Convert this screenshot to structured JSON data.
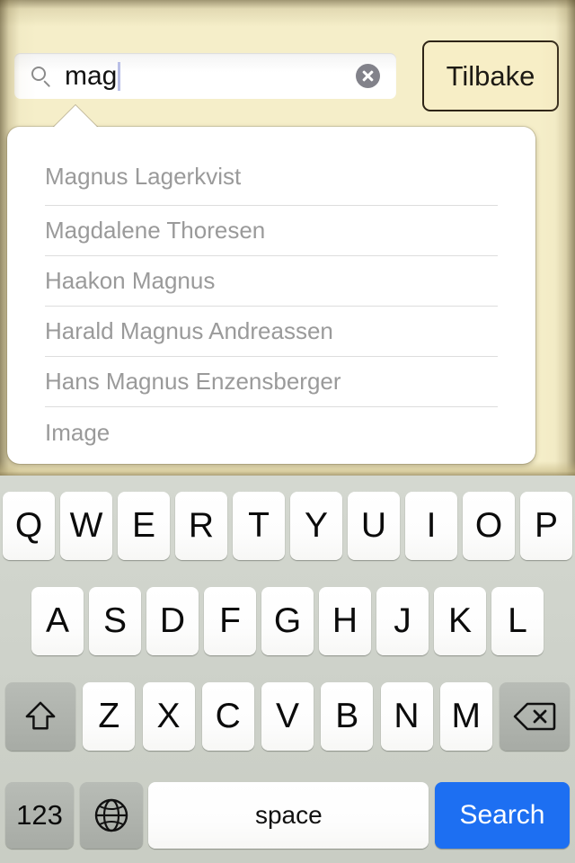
{
  "search": {
    "value": "mag",
    "placeholder": "Search",
    "icon": "search-icon",
    "clear_icon": "clear-circle-icon",
    "back_button_label": "Tilbake"
  },
  "suggestions": {
    "items": [
      {
        "label": "Magnus Lagerkvist"
      },
      {
        "label": "Magdalene Thoresen"
      },
      {
        "label": "Haakon Magnus"
      },
      {
        "label": "Harald Magnus Andreassen"
      },
      {
        "label": "Hans Magnus Enzensberger"
      },
      {
        "label": "Image"
      }
    ]
  },
  "keyboard": {
    "row1": [
      "Q",
      "W",
      "E",
      "R",
      "T",
      "Y",
      "U",
      "I",
      "O",
      "P"
    ],
    "row2": [
      "A",
      "S",
      "D",
      "F",
      "G",
      "H",
      "J",
      "K",
      "L"
    ],
    "row3": [
      "Z",
      "X",
      "C",
      "V",
      "B",
      "N",
      "M"
    ],
    "shift_icon": "shift-arrow-icon",
    "backspace_icon": "backspace-icon",
    "numeric_label": "123",
    "globe_icon": "globe-icon",
    "space_label": "space",
    "search_label": "Search"
  },
  "colors": {
    "paper": "#f5eec9",
    "accent_search_key": "#1d6ff2",
    "suggestion_text": "#9a9a9a",
    "keyboard_background": "#cdd1c9",
    "key_face": "#ffffff",
    "modifier_key": "#aeb2ac",
    "back_button_border": "#2e2416"
  }
}
